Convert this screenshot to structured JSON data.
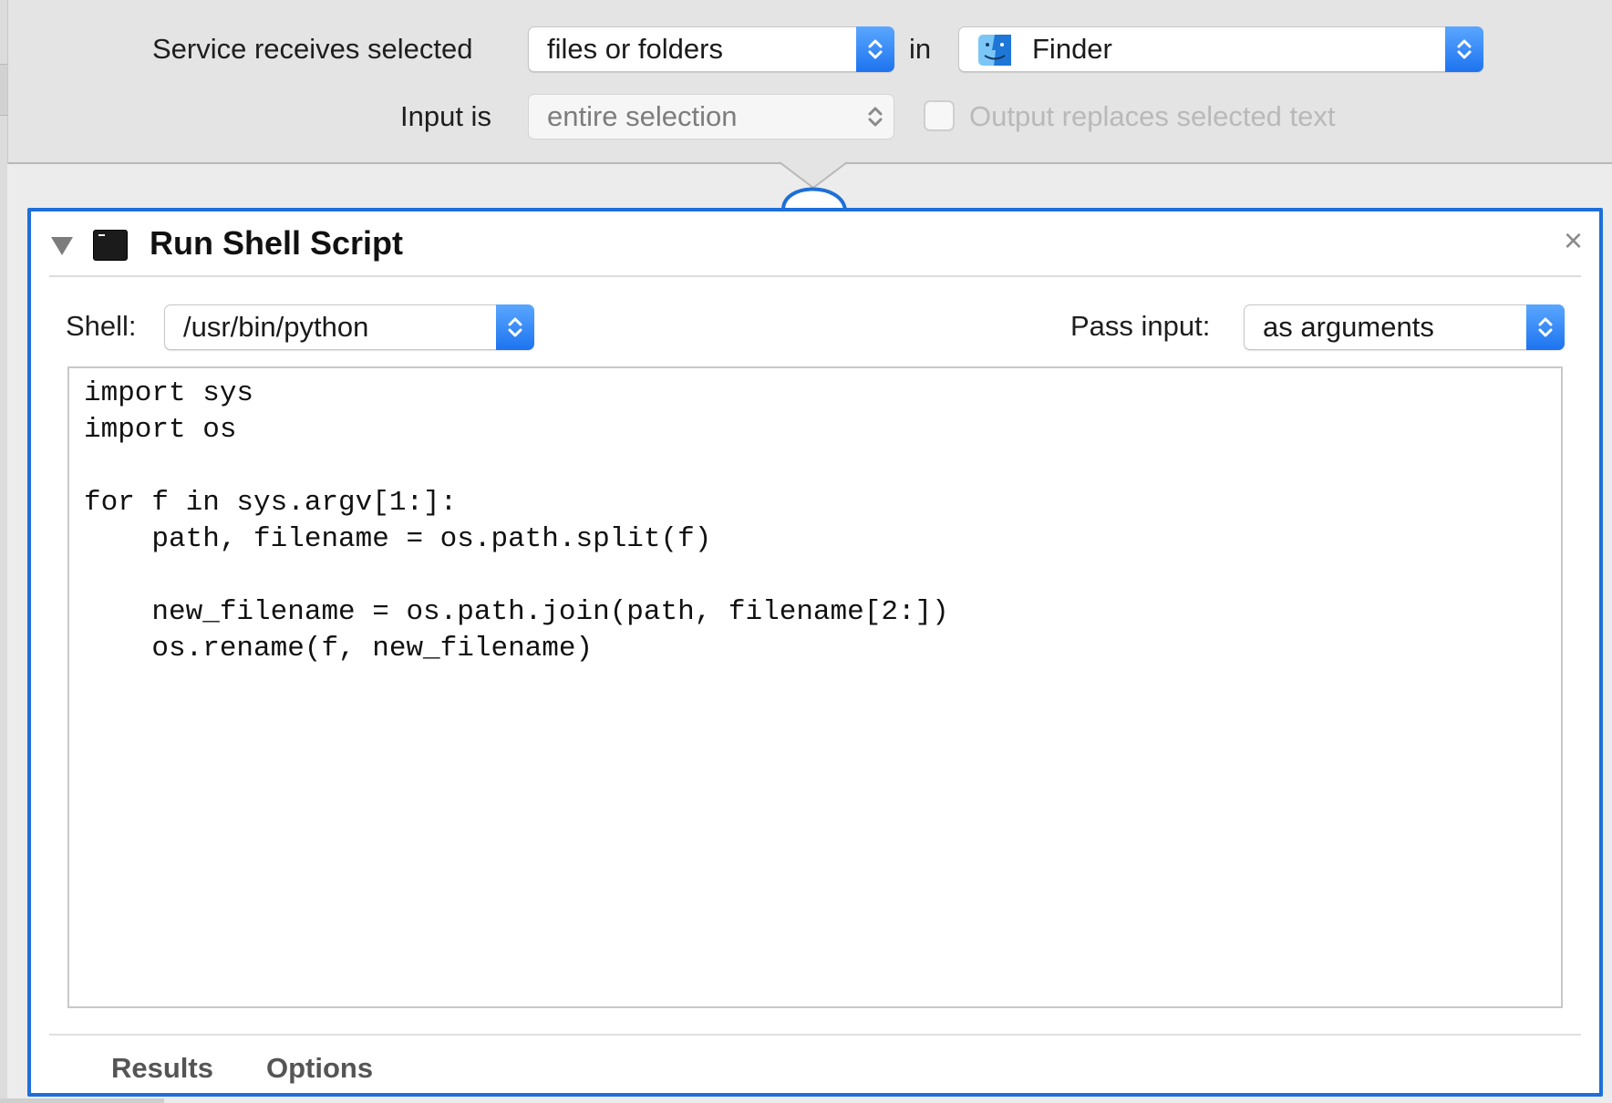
{
  "service": {
    "receives_label": "Service receives selected",
    "receives_value": "files or folders",
    "in_label": "in",
    "app_value": "Finder",
    "app_icon": "finder-icon",
    "input_label": "Input is",
    "input_value": "entire selection",
    "output_checkbox_label": "Output replaces selected text"
  },
  "action": {
    "title": "Run Shell Script",
    "icon": "terminal-icon",
    "close_glyph": "×",
    "shell_label": "Shell:",
    "shell_value": "/usr/bin/python",
    "pass_input_label": "Pass input:",
    "pass_input_value": "as arguments",
    "script": "import sys\nimport os\n\nfor f in sys.argv[1:]:\n    path, filename = os.path.split(f)\n\n    new_filename = os.path.join(path, filename[2:])\n    os.rename(f, new_filename)",
    "tabs": [
      "Results",
      "Options"
    ]
  },
  "colors": {
    "accent": "#1e6fd8",
    "stepper": "#1d73f0"
  }
}
